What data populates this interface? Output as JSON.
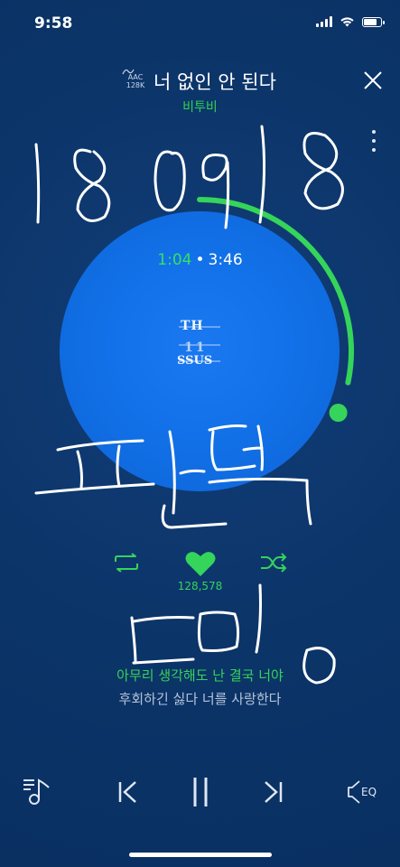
{
  "status_bar": {
    "time": "9:58",
    "battery_level": 0.85
  },
  "header": {
    "codec_name": "AAC",
    "codec_bitrate": "128K",
    "title": "너 없인 안 된다",
    "artist": "비투비"
  },
  "player": {
    "current_time": "1:04",
    "separator": "•",
    "total_time": "3:46",
    "progress_fraction": 0.283,
    "album_art_text_line1": "TH",
    "album_art_text_line2": "11",
    "album_art_text_line3": "SSUS"
  },
  "controls": {
    "like_count": "128,578"
  },
  "lyrics": {
    "current": "아무리 생각해도 난 결국 너야",
    "next": "후회하긴 싫다 너를 사랑한다"
  },
  "bottom_bar": {
    "eq_label": "EQ"
  },
  "colors": {
    "background": "#0b3468",
    "accent_green": "#35d45a",
    "disc_blue": "#1271e8"
  },
  "icons": [
    "signal-icon",
    "wifi-icon",
    "battery-icon",
    "close-icon",
    "more-icon",
    "repeat-icon",
    "heart-icon",
    "shuffle-icon",
    "playlist-icon",
    "previous-icon",
    "pause-icon",
    "next-icon",
    "eq-icon"
  ]
}
